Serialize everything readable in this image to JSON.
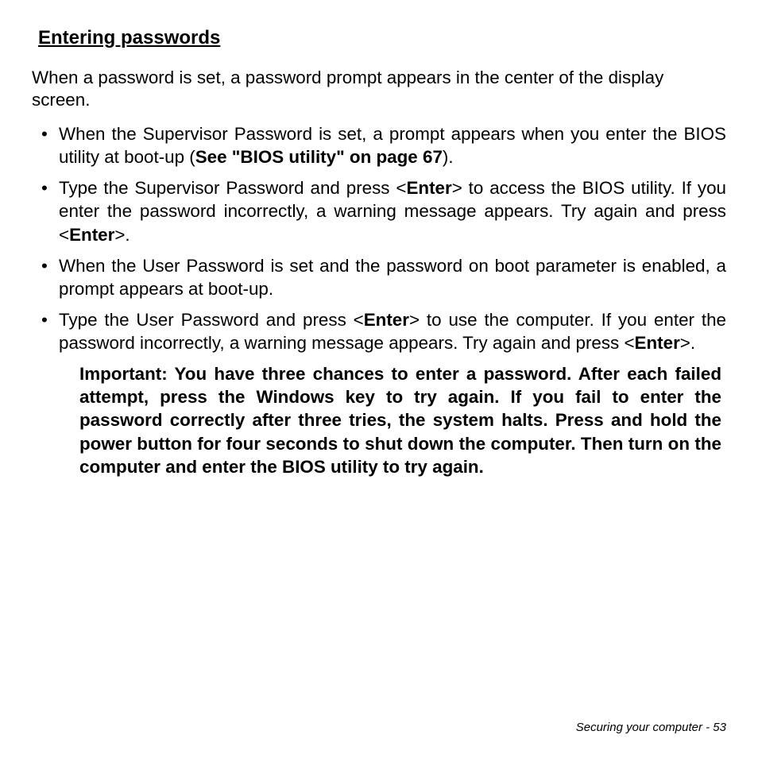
{
  "heading": "Entering passwords",
  "intro": "When a password is set, a password prompt appears in the center of the display screen.",
  "bullets": [
    {
      "t1": "When the Supervisor Password is set, a prompt appears when you enter the BIOS utility at boot-up (",
      "b1": "See \"BIOS utility\" on page 67",
      "t2": ")."
    },
    {
      "t1": "Type the Supervisor Password and press <",
      "b1": "Enter",
      "t2": "> to access the BIOS utility. If you enter the password incorrectly, a warning message appears. Try again and press <",
      "b2": "Enter",
      "t3": ">."
    },
    {
      "t1": "When the User Password is set and the password on boot parameter is enabled, a prompt appears at boot-up."
    },
    {
      "t1": "Type the User Password and press <",
      "b1": "Enter",
      "t2": "> to use the computer. If you enter the password incorrectly, a warning message appears. Try again and press <",
      "b2": "Enter",
      "t3": ">."
    }
  ],
  "important": "Important: You have three chances to enter a password. After each failed attempt, press the Windows key to try again. If you fail to enter the password correctly after three tries, the system halts. Press and hold the power button for four seconds to shut down the computer. Then turn on the computer and enter the BIOS utility to try again.",
  "footer": "Securing your computer -  53"
}
